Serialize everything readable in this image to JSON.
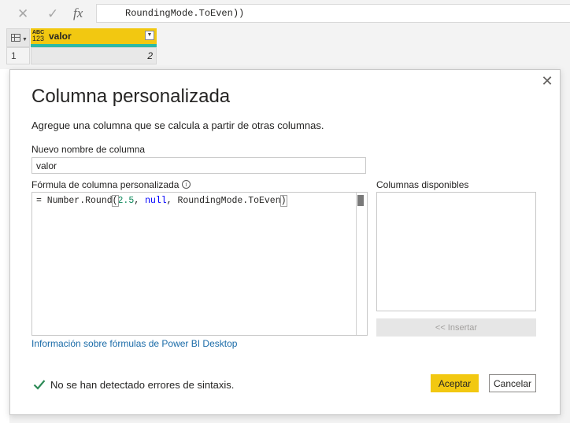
{
  "formula_bar": {
    "cancel_icon": "close-icon",
    "commit_icon": "check-icon",
    "fx_label": "fx",
    "formula_visible": "RoundingMode.ToEven))"
  },
  "grid": {
    "column": {
      "type_top": "ABC",
      "type_bottom": "123",
      "name": "valor"
    },
    "rows": [
      {
        "num": "1",
        "value": "2"
      }
    ]
  },
  "dialog": {
    "title": "Columna personalizada",
    "description": "Agregue una columna que se calcula a partir de otras columnas.",
    "name_label": "Nuevo nombre de columna",
    "name_value": "valor",
    "formula_label": "Fórmula de columna personalizada",
    "formula": {
      "prefix": "= Number.Round",
      "open_paren": "(",
      "arg1": "2.5",
      "sep1": ", ",
      "arg2": "null",
      "sep2": ", RoundingMode.ToEven",
      "close_paren": ")"
    },
    "available_label": "Columnas disponibles",
    "insert_label": "<< Insertar",
    "help_link": "Información sobre fórmulas de Power BI Desktop",
    "status": "No se han detectado errores de sintaxis.",
    "ok_label": "Aceptar",
    "cancel_label": "Cancelar",
    "colors": {
      "accent": "#f2c811",
      "ok": "#2e8b57",
      "link": "#1a6ba8"
    }
  }
}
